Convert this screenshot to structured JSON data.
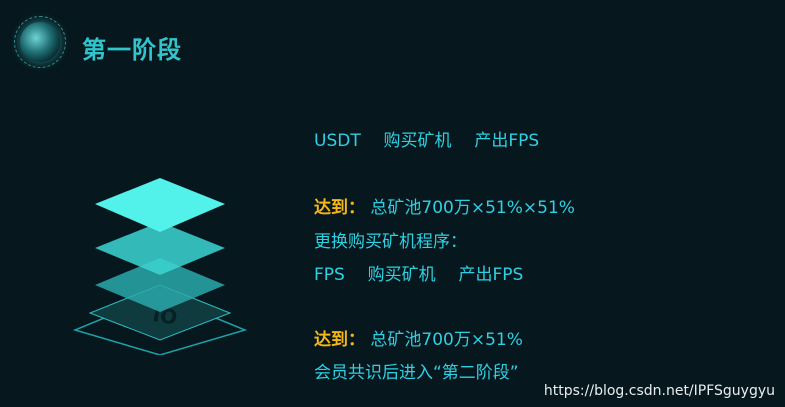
{
  "header": {
    "title": "第一阶段"
  },
  "flow1": {
    "a": "USDT",
    "b": "购买矿机",
    "c": "产出FPS"
  },
  "row2": {
    "label": "达到：",
    "text": "总矿池700万×51%×51%"
  },
  "row3": {
    "text": "更换购买矿机程序："
  },
  "flow2": {
    "a": "FPS",
    "b": "购买矿机",
    "c": "产出FPS"
  },
  "row5": {
    "label": "达到：",
    "text": "总矿池700万×51%"
  },
  "row6": {
    "text": "会员共识后进入“第二阶段”"
  },
  "watermark": "https://blog.csdn.net/IPFSguygyu",
  "colors": {
    "accent": "#2fd0e2",
    "highlight": "#f5b61a",
    "background": "#06181e"
  },
  "icons": {
    "logo": "globe-icon",
    "arrow": "right-arrow-icon",
    "illustration": "layered-stack-icon"
  }
}
